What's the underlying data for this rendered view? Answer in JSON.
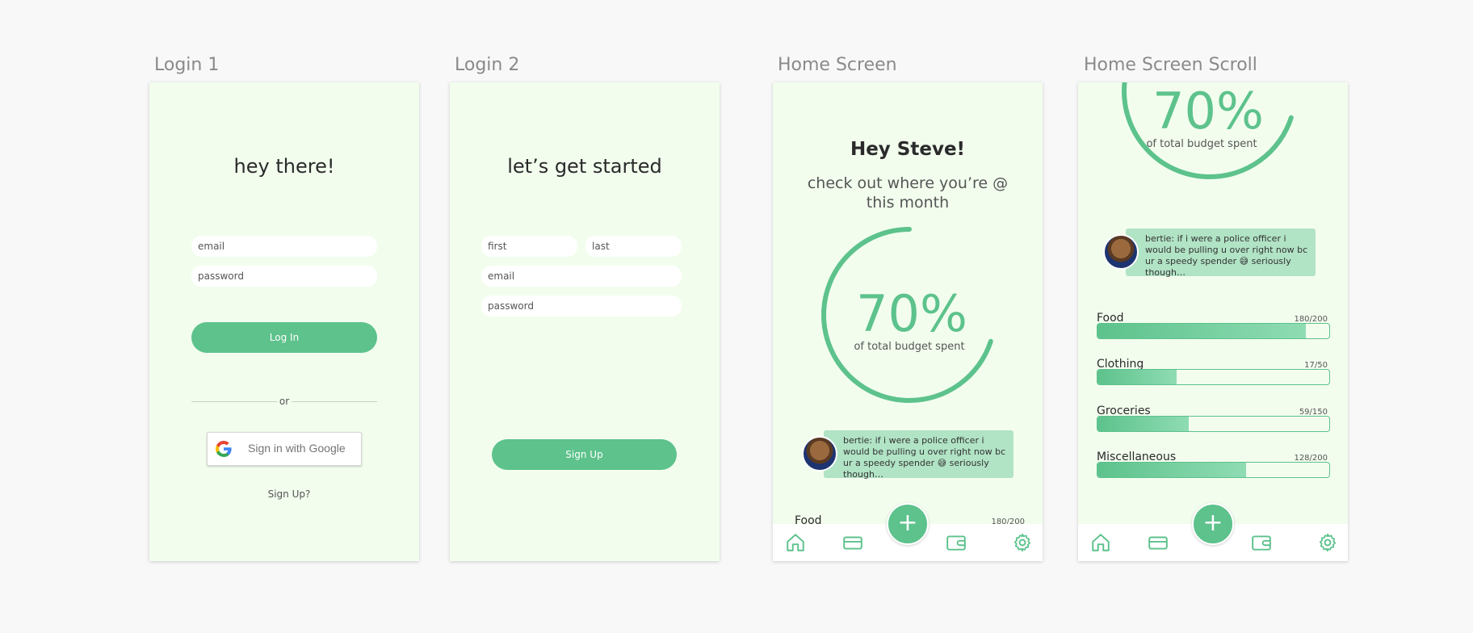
{
  "frames": {
    "login1": {
      "title": "Login 1",
      "heading": "hey there!",
      "email_placeholder": "email",
      "password_placeholder": "password",
      "login_label": "Log In",
      "divider_text": "or",
      "google_label": "Sign in with Google",
      "signup_link": "Sign Up?"
    },
    "login2": {
      "title": "Login 2",
      "heading": "let’s get started",
      "first_placeholder": "first",
      "last_placeholder": "last",
      "email_placeholder": "email",
      "password_placeholder": "password",
      "signup_label": "Sign Up"
    },
    "home": {
      "title": "Home Screen",
      "greeting": "Hey Steve!",
      "subtitle": "check out where you’re @ this month",
      "percent": "70%",
      "percent_caption": "of total budget spent",
      "message": "bertie: if i were a police officer i would be pulling u over right now bc ur a speedy spender 😅 seriously though…",
      "peek_category": {
        "name": "Food",
        "amount": "180/200"
      },
      "fab": "+"
    },
    "home_scroll": {
      "title": "Home Screen Scroll",
      "percent": "70%",
      "percent_caption": "of total budget spent",
      "message": "bertie: if i were a police officer i would be pulling u over right now bc ur a speedy spender 😅 seriously though…",
      "categories": [
        {
          "name": "Food",
          "amount": "180/200",
          "fraction": 0.9
        },
        {
          "name": "Clothing",
          "amount": "17/50",
          "fraction": 0.34
        },
        {
          "name": "Groceries",
          "amount": "59/150",
          "fraction": 0.393
        },
        {
          "name": "Miscellaneous",
          "amount": "128/200",
          "fraction": 0.64
        }
      ],
      "fab": "+"
    }
  },
  "colors": {
    "accent": "#5dc28c",
    "frame_background": "#f2fdee",
    "message_background": "#b1e3c5"
  },
  "icons": [
    "home-icon",
    "card-icon",
    "wallet-icon",
    "gear-icon",
    "google-logo-icon",
    "plus-icon"
  ]
}
